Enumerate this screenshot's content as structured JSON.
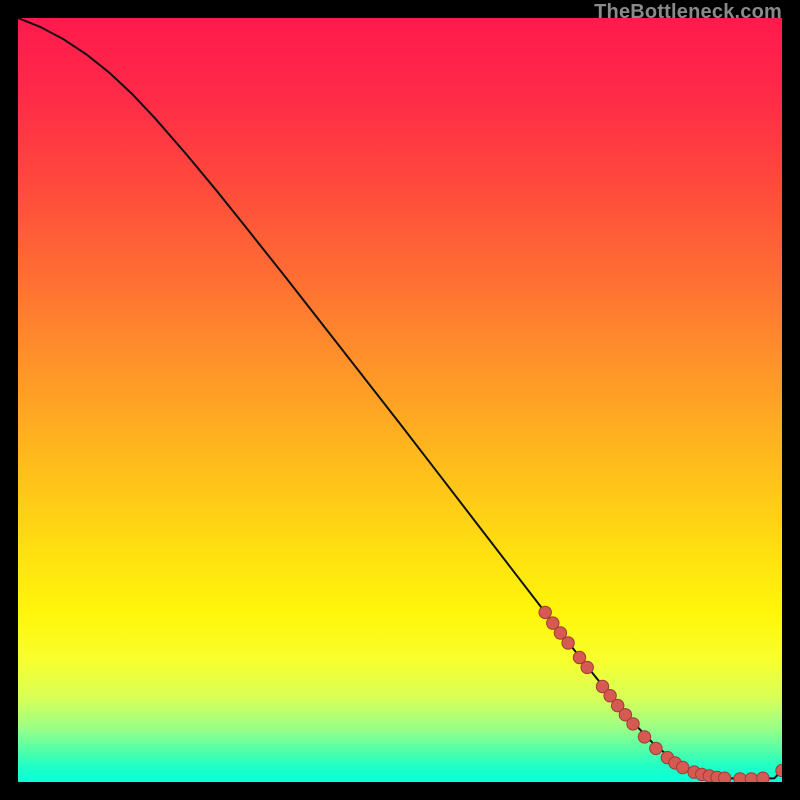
{
  "watermark": "TheBottleneck.com",
  "colors": {
    "page_bg": "#000000",
    "curve": "#111111",
    "dot_fill": "#d65a52",
    "dot_stroke": "#9f3c37",
    "watermark": "#8a8a8a"
  },
  "chart_data": {
    "type": "line",
    "title": "",
    "xlabel": "",
    "ylabel": "",
    "xlim": [
      0,
      100
    ],
    "ylim": [
      0,
      100
    ],
    "grid": false,
    "legend": false,
    "series": [
      {
        "name": "bottleneck-curve",
        "x": [
          0,
          3,
          6,
          9,
          12,
          15,
          18,
          22,
          26,
          30,
          35,
          40,
          45,
          50,
          55,
          60,
          65,
          69,
          72,
          75,
          78,
          81,
          83,
          85,
          87,
          89,
          91,
          93,
          95,
          97,
          99,
          100
        ],
        "y": [
          100,
          98.8,
          97.2,
          95.2,
          92.8,
          90.0,
          86.8,
          82.2,
          77.4,
          72.4,
          66.1,
          59.7,
          53.3,
          46.9,
          40.4,
          33.9,
          27.4,
          22.2,
          18.3,
          14.5,
          10.8,
          7.3,
          5.2,
          3.5,
          2.2,
          1.3,
          0.8,
          0.5,
          0.4,
          0.4,
          0.5,
          1.5
        ]
      }
    ],
    "points": [
      {
        "name": "p1",
        "x": 69.0,
        "y": 22.2
      },
      {
        "name": "p2",
        "x": 70.0,
        "y": 20.8
      },
      {
        "name": "p3",
        "x": 71.0,
        "y": 19.5
      },
      {
        "name": "p4",
        "x": 72.0,
        "y": 18.2
      },
      {
        "name": "p5",
        "x": 73.5,
        "y": 16.3
      },
      {
        "name": "p6",
        "x": 74.5,
        "y": 15.0
      },
      {
        "name": "p7",
        "x": 76.5,
        "y": 12.5
      },
      {
        "name": "p8",
        "x": 77.5,
        "y": 11.3
      },
      {
        "name": "p9",
        "x": 78.5,
        "y": 10.0
      },
      {
        "name": "p10",
        "x": 79.5,
        "y": 8.8
      },
      {
        "name": "p11",
        "x": 80.5,
        "y": 7.6
      },
      {
        "name": "p12",
        "x": 82.0,
        "y": 5.9
      },
      {
        "name": "p13",
        "x": 83.5,
        "y": 4.4
      },
      {
        "name": "p14",
        "x": 85.0,
        "y": 3.2
      },
      {
        "name": "p15",
        "x": 86.0,
        "y": 2.5
      },
      {
        "name": "p16",
        "x": 87.0,
        "y": 1.9
      },
      {
        "name": "p17",
        "x": 88.5,
        "y": 1.3
      },
      {
        "name": "p18",
        "x": 89.5,
        "y": 1.0
      },
      {
        "name": "p19",
        "x": 90.5,
        "y": 0.8
      },
      {
        "name": "p20",
        "x": 91.5,
        "y": 0.6
      },
      {
        "name": "p21",
        "x": 92.5,
        "y": 0.5
      },
      {
        "name": "p22",
        "x": 94.5,
        "y": 0.4
      },
      {
        "name": "p23",
        "x": 96.0,
        "y": 0.4
      },
      {
        "name": "p24",
        "x": 97.5,
        "y": 0.5
      },
      {
        "name": "p25",
        "x": 100.0,
        "y": 1.5
      }
    ]
  }
}
